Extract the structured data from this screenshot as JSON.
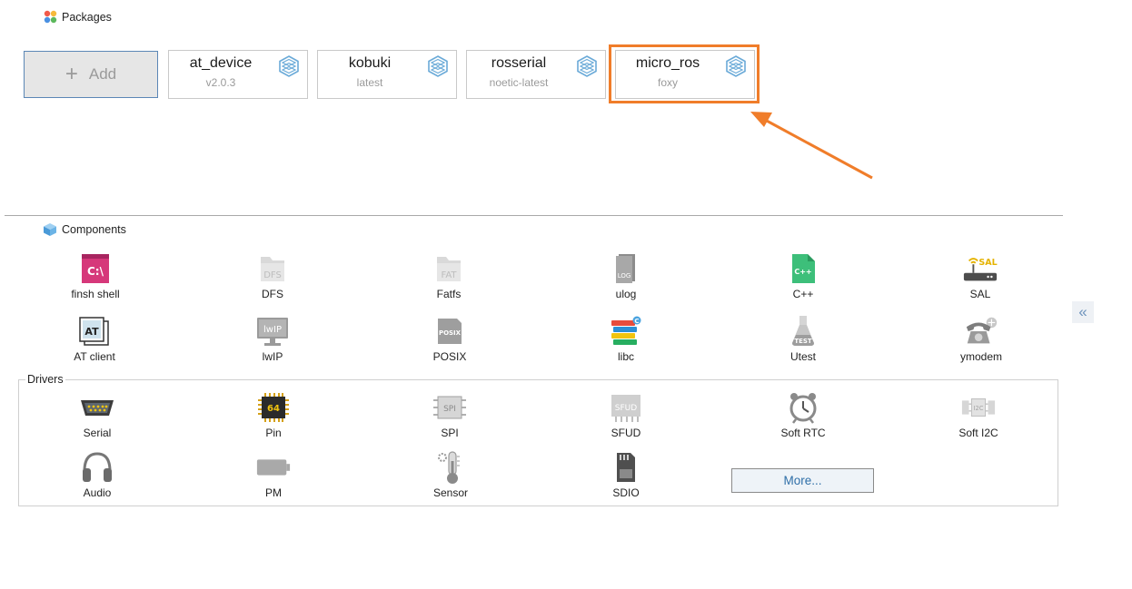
{
  "packages": {
    "title": "Packages",
    "add_label": "Add",
    "items": [
      {
        "name": "at_device",
        "version": "v2.0.3"
      },
      {
        "name": "kobuki",
        "version": "latest"
      },
      {
        "name": "rosserial",
        "version": "noetic-latest"
      },
      {
        "name": "micro_ros",
        "version": "foxy"
      }
    ],
    "highlight_color": "#f07d2a"
  },
  "components": {
    "title": "Components",
    "items": [
      {
        "label": "finsh shell",
        "icon": "terminal-icon"
      },
      {
        "label": "DFS",
        "icon": "dfs-folder-icon"
      },
      {
        "label": "Fatfs",
        "icon": "fat-folder-icon"
      },
      {
        "label": "ulog",
        "icon": "log-file-icon"
      },
      {
        "label": "C++",
        "icon": "cpp-file-icon"
      },
      {
        "label": "SAL",
        "icon": "router-icon"
      },
      {
        "label": "AT client",
        "icon": "at-window-icon"
      },
      {
        "label": "lwIP",
        "icon": "monitor-icon"
      },
      {
        "label": "POSIX",
        "icon": "posix-doc-icon"
      },
      {
        "label": "libc",
        "icon": "books-icon"
      },
      {
        "label": "Utest",
        "icon": "flask-icon"
      },
      {
        "label": "ymodem",
        "icon": "phone-icon"
      }
    ]
  },
  "drivers": {
    "title": "Drivers",
    "items": [
      {
        "label": "Serial",
        "icon": "serial-port-icon"
      },
      {
        "label": "Pin",
        "icon": "chip-icon"
      },
      {
        "label": "SPI",
        "icon": "spi-chip-icon"
      },
      {
        "label": "SFUD",
        "icon": "sfud-chip-icon"
      },
      {
        "label": "Soft RTC",
        "icon": "alarm-clock-icon"
      },
      {
        "label": "Soft I2C",
        "icon": "i2c-chip-icon"
      },
      {
        "label": "Audio",
        "icon": "headphones-icon"
      },
      {
        "label": "PM",
        "icon": "battery-icon"
      },
      {
        "label": "Sensor",
        "icon": "thermometer-icon"
      },
      {
        "label": "SDIO",
        "icon": "sd-card-icon"
      }
    ],
    "more_label": "More..."
  },
  "collapse_label": "«"
}
